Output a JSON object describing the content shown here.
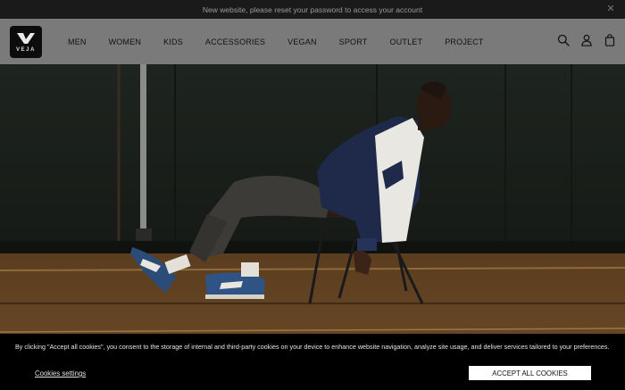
{
  "announcement": {
    "text": "New website, please reset your password to access your account",
    "close_icon": "close-icon"
  },
  "header": {
    "logo_text": "VEJA",
    "nav": [
      "MEN",
      "WOMEN",
      "KIDS",
      "ACCESSORIES",
      "VEGAN",
      "SPORT",
      "OUTLET",
      "PROJECT"
    ],
    "icons": [
      "search-icon",
      "account-icon",
      "bag-icon"
    ]
  },
  "hero": {
    "image": "man-reclining-on-chair-in-gym-wearing-sneakers"
  },
  "cookie_banner": {
    "text": "By clicking \"Accept all cookies\", you consent to the storage of internal and third-party cookies on your device to enhance website navigation, analyze site usage, and deliver services tailored to your preferences.",
    "settings_label": "Cookies settings",
    "accept_label": "ACCEPT ALL COOKIES"
  }
}
